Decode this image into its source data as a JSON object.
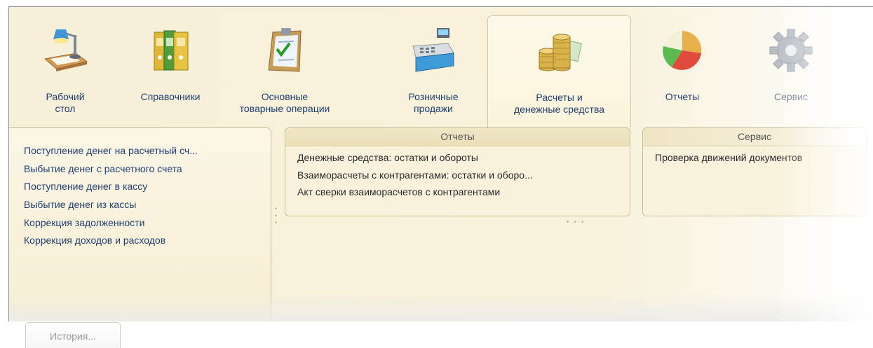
{
  "sections": [
    {
      "id": "desk",
      "label": "Рабочий\nстол",
      "icon": "desk-lamp-icon"
    },
    {
      "id": "ref",
      "label": "Справочники",
      "icon": "binders-icon"
    },
    {
      "id": "goods",
      "label": "Основные\nтоварные операции",
      "icon": "clipboard-icon"
    },
    {
      "id": "retail",
      "label": "Розничные\nпродажи",
      "icon": "cash-register-icon"
    },
    {
      "id": "money",
      "label": "Расчеты и\nденежные средства",
      "icon": "coins-icon",
      "active": true
    },
    {
      "id": "reports",
      "label": "Отчеты",
      "icon": "pie-chart-icon"
    },
    {
      "id": "service",
      "label": "Сервис",
      "icon": "gear-icon"
    }
  ],
  "nav": {
    "items": [
      "Поступление денег на расчетный сч...",
      "Выбытие денег с расчетного счета",
      "Поступление денег в кассу",
      "Выбытие денег из кассы",
      "Коррекция задолженности",
      "Коррекция доходов и расходов"
    ]
  },
  "groups": {
    "reports": {
      "title": "Отчеты",
      "items": [
        "Денежные средства: остатки и обороты",
        "Взаиморасчеты с контрагентами: остатки и оборо...",
        "Акт сверки взаиморасчетов с контрагентами"
      ]
    },
    "service": {
      "title": "Сервис",
      "items": [
        "Проверка движений документов"
      ]
    }
  },
  "footer": {
    "history_label": "История..."
  }
}
